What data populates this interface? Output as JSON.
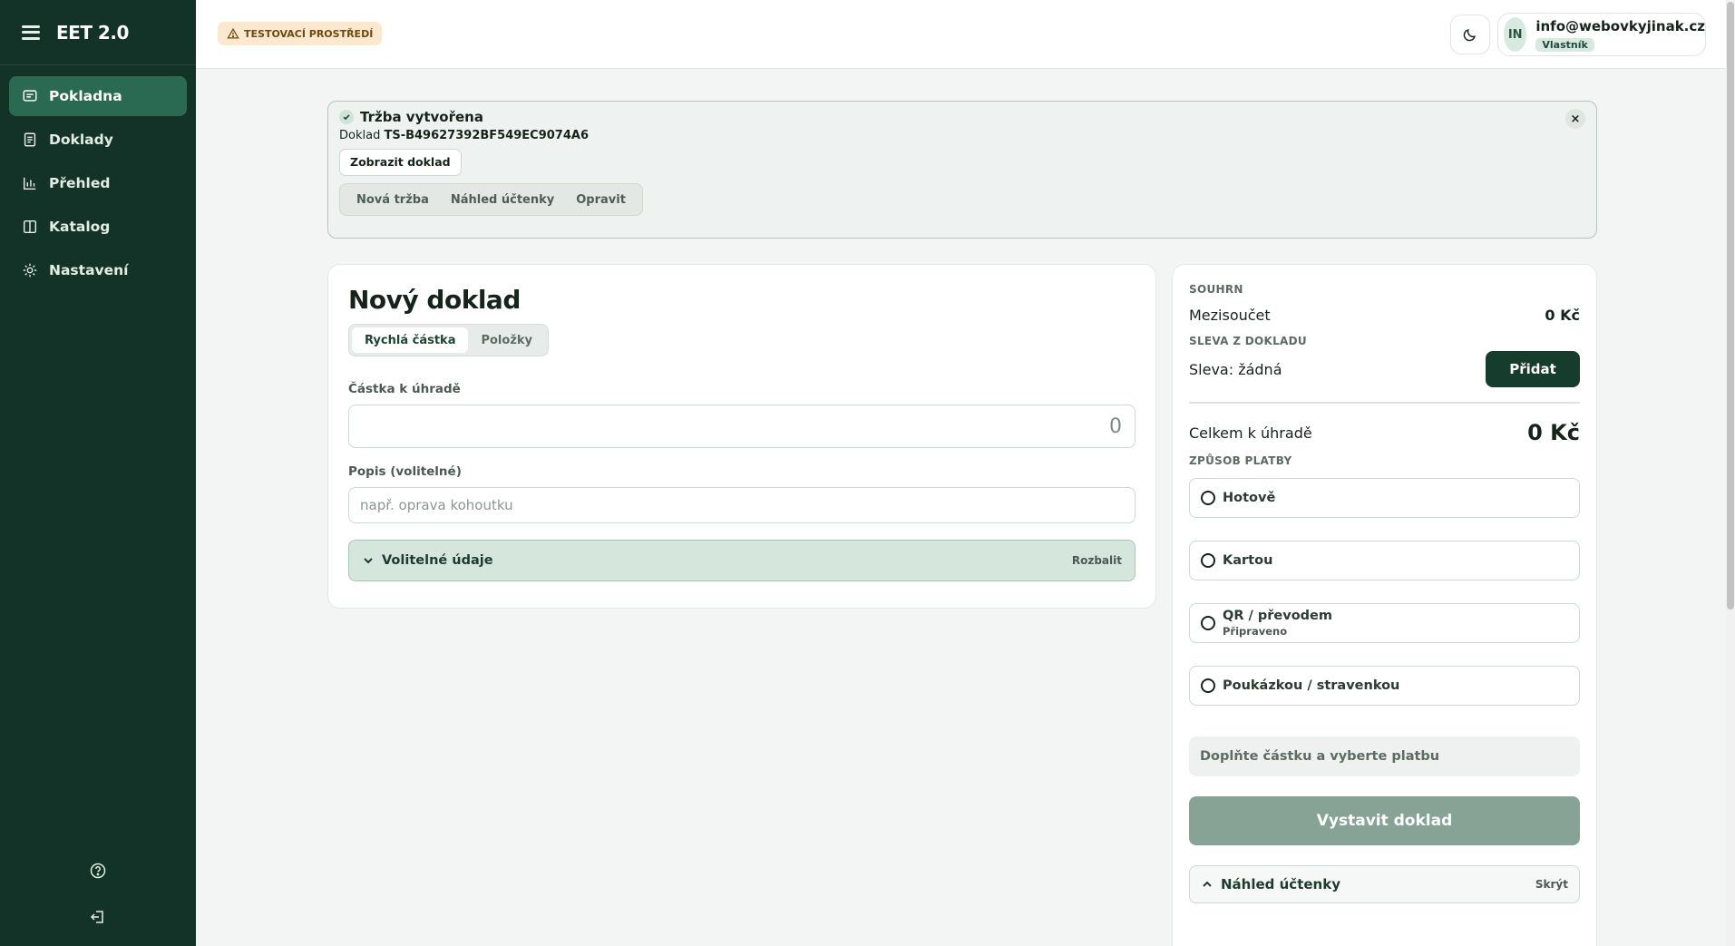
{
  "app": {
    "title": "EET 2.0"
  },
  "sidebar": {
    "items": [
      {
        "label": "Pokladna",
        "icon": "receipt-icon",
        "active": true
      },
      {
        "label": "Doklady",
        "icon": "document-icon",
        "active": false
      },
      {
        "label": "Přehled",
        "icon": "chart-icon",
        "active": false
      },
      {
        "label": "Katalog",
        "icon": "book-icon",
        "active": false
      },
      {
        "label": "Nastavení",
        "icon": "settings-icon",
        "active": false
      }
    ],
    "bottom_icons": [
      "help-icon",
      "logout-icon"
    ]
  },
  "header": {
    "env_badge": "TESTOVACÍ PROSTŘEDÍ",
    "user_initials": "IN",
    "user_email": "info@webovkyjinak.cz",
    "user_role": "Vlastník"
  },
  "banner": {
    "title": "Tržba vytvořena",
    "doc_prefix": "Doklad",
    "doc_id": "TS-B49627392BF549EC9074A6",
    "show_doc_label": "Zobrazit doklad",
    "actions": [
      "Nová tržba",
      "Náhled účtenky",
      "Opravit"
    ],
    "close_label": "×"
  },
  "form": {
    "title": "Nový doklad",
    "modes": [
      "Rychlá částka",
      "Položky"
    ],
    "amount_label": "Částka k úhradě",
    "amount_value": "0",
    "description_label": "Popis (volitelné)",
    "description_placeholder": "např. oprava kohoutku",
    "optional_label": "Volitelné údaje",
    "optional_toggle": "Rozbalit"
  },
  "summary": {
    "section_title": "SOUHRN",
    "subtotal_label": "Mezisoučet",
    "subtotal_value": "0 Kč",
    "discount_section": "SLEVA Z DOKLADU",
    "discount_label": "Sleva: žádná",
    "discount_add": "Přidat",
    "total_label": "Celkem k úhradě",
    "total_value": "0 Kč",
    "payment_section": "ZPŮSOB PLATBY",
    "payments": [
      {
        "label": "Hotově",
        "sub": ""
      },
      {
        "label": "Kartou",
        "sub": ""
      },
      {
        "label": "QR / převodem",
        "sub": "Připraveno"
      },
      {
        "label": "Poukázkou / stravenkou",
        "sub": ""
      }
    ],
    "hint": "Doplňte částku a vyberte platbu",
    "issue_button": "Vystavit doklad",
    "preview_label": "Náhled účtenky",
    "preview_toggle": "Skrýt"
  }
}
